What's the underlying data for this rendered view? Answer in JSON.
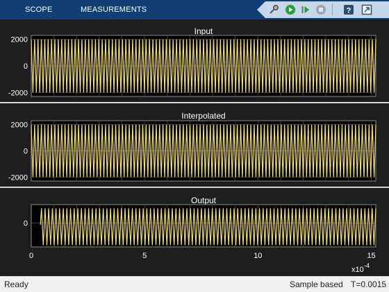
{
  "toolbar": {
    "tabs": [
      "SCOPE",
      "MEASUREMENTS"
    ],
    "icons": [
      "configure-icon",
      "run-icon",
      "step-forward-icon",
      "stop-icon",
      "help-icon",
      "undock-icon"
    ]
  },
  "colors": {
    "signal": "#f5e16a",
    "background": "#1e1e1e",
    "axes": "#000000",
    "grid": "#3c3c3c",
    "text": "#ffffff",
    "header": "#0f3f75"
  },
  "chart_data": [
    {
      "type": "line",
      "title": "Input",
      "ylim": [
        -2300,
        2300
      ],
      "yticks": [
        2000,
        0,
        -2000
      ],
      "xlim": [
        0,
        15.2
      ],
      "x_scale_label": "x10",
      "x_scale_exponent": "-4",
      "signal": {
        "amplitude": 2000,
        "offset": 0,
        "cycles": 102,
        "start": 0
      },
      "grid": true
    },
    {
      "type": "line",
      "title": "Interpolated",
      "ylim": [
        -2300,
        2300
      ],
      "yticks": [
        2000,
        0,
        -2000
      ],
      "xlim": [
        0,
        15.2
      ],
      "signal": {
        "amplitude": 2000,
        "offset": 0,
        "cycles": 102,
        "start": 0
      },
      "grid": true
    },
    {
      "type": "line",
      "title": "Output",
      "ylim": [
        -1.3,
        1.0
      ],
      "yticks": [
        0
      ],
      "xlim": [
        0,
        15.2
      ],
      "xticks": [
        0,
        5,
        10,
        15
      ],
      "signal": {
        "amplitude": 1,
        "offset": -0.2,
        "cycles": 92,
        "start": 0.45
      },
      "grid": true
    }
  ],
  "status": {
    "left": "Ready",
    "mode": "Sample based",
    "time": "T=0.0015"
  }
}
